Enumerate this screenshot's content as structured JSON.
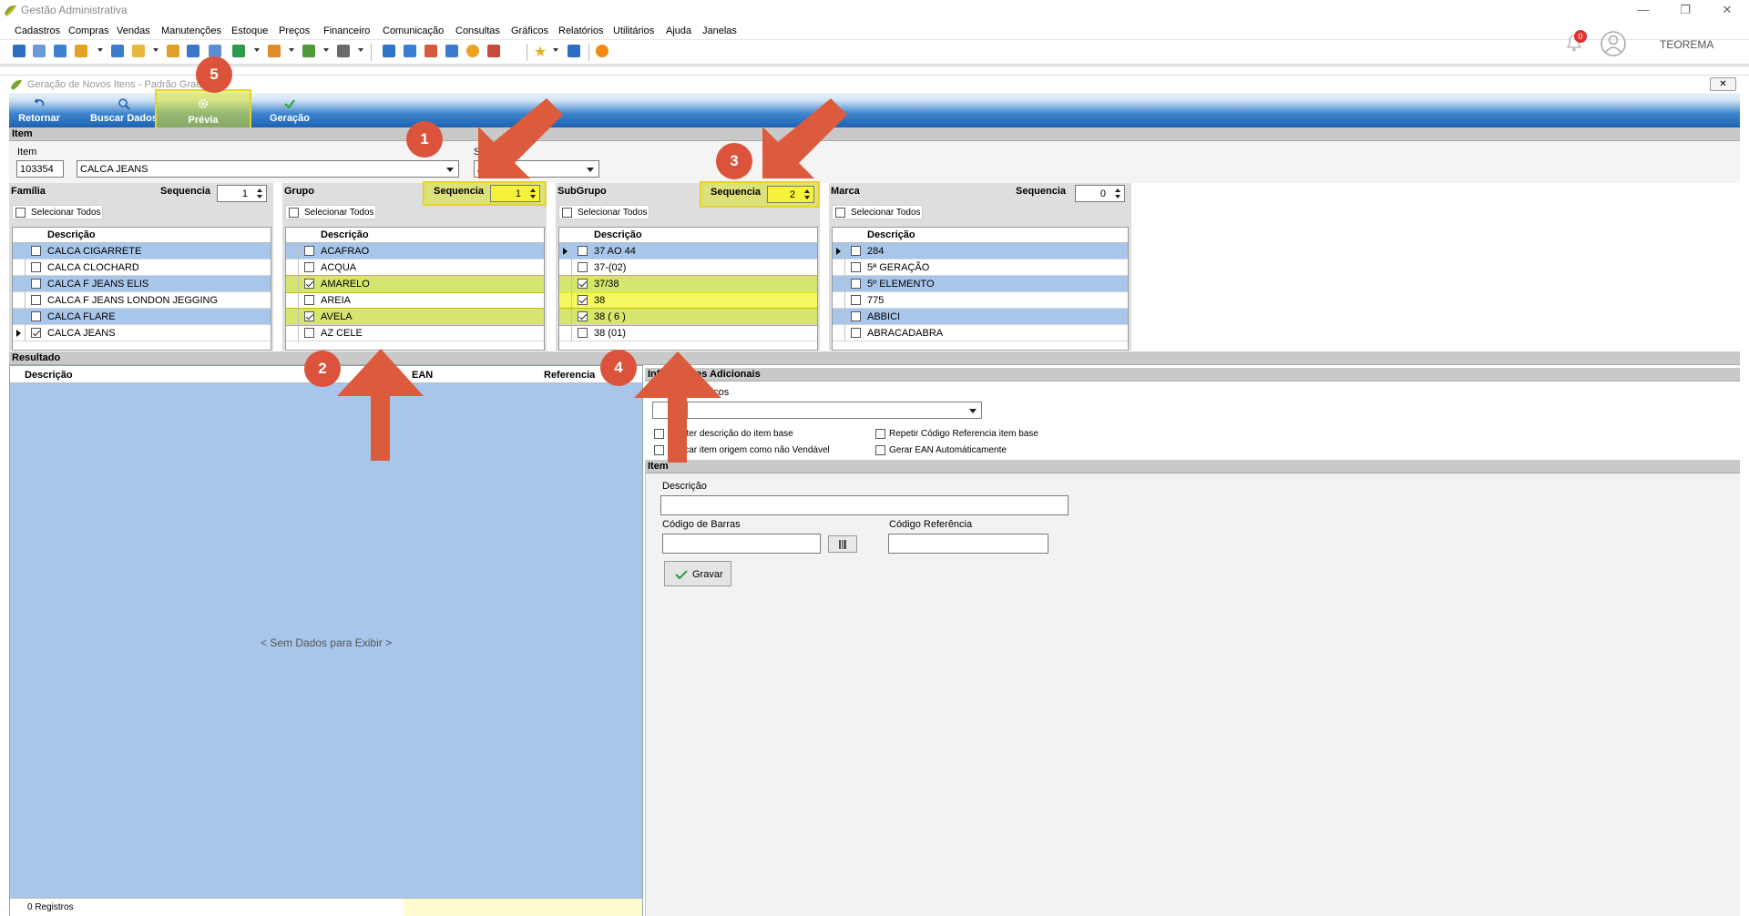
{
  "app": {
    "title": "Gestão Administrativa",
    "user": "TEOREMA",
    "notification_count": "0"
  },
  "menu": [
    "Cadastros",
    "Compras",
    "Vendas",
    "Manutenções",
    "Estoque",
    "Preços",
    "Financeiro",
    "Comunicação",
    "Consultas",
    "Gráficos",
    "Relatórios",
    "Utilitários",
    "Ajuda",
    "Janelas"
  ],
  "window": {
    "title": "Geração de Novos Itens - Padrão Grade"
  },
  "ribbon": {
    "retornar": "Retornar",
    "buscar": "Buscar Dados",
    "previa": "Prévia",
    "geracao": "Geração"
  },
  "item_section": {
    "title": "Item",
    "item_label": "Item",
    "code": "103354",
    "name": "CALCA JEANS",
    "se_label": "Se",
    "se_value": "/"
  },
  "familia": {
    "title": "Família",
    "seq_label": "Sequencia",
    "seq": "1",
    "select_all": "Selecionar Todos",
    "col": "Descrição",
    "rows": [
      {
        "text": "CALCA CIGARRETE",
        "checked": false
      },
      {
        "text": "CALCA CLOCHARD",
        "checked": false
      },
      {
        "text": "CALCA F JEANS ELIS",
        "checked": false
      },
      {
        "text": "CALCA F JEANS LONDON JEGGING",
        "checked": false
      },
      {
        "text": "CALCA FLARE",
        "checked": false
      },
      {
        "text": "CALCA JEANS",
        "checked": true
      }
    ]
  },
  "grupo": {
    "title": "Grupo",
    "seq_label": "Sequencia",
    "seq": "1",
    "select_all": "Selecionar Todos",
    "col": "Descrição",
    "rows": [
      {
        "text": "ACAFRAO",
        "checked": false
      },
      {
        "text": "ACQUA",
        "checked": false
      },
      {
        "text": "AMARELO",
        "checked": true
      },
      {
        "text": "AREIA",
        "checked": false
      },
      {
        "text": "AVELA",
        "checked": true
      },
      {
        "text": "AZ CELE",
        "checked": false
      }
    ]
  },
  "subgrupo": {
    "title": "SubGrupo",
    "seq_label": "Sequencia",
    "seq": "2",
    "select_all": "Selecionar Todos",
    "col": "Descrição",
    "rows": [
      {
        "text": "37 AO 44",
        "checked": false
      },
      {
        "text": "37-(02)",
        "checked": false
      },
      {
        "text": "37/38",
        "checked": true
      },
      {
        "text": "38",
        "checked": true
      },
      {
        "text": "38 ( 6 )",
        "checked": true
      },
      {
        "text": "38 (01)",
        "checked": false
      }
    ]
  },
  "marca": {
    "title": "Marca",
    "seq_label": "Sequencia",
    "seq": "0",
    "select_all": "Selecionar Todos",
    "col": "Descrição",
    "rows": [
      {
        "text": "284",
        "checked": false
      },
      {
        "text": "5ª GERAÇÃO",
        "checked": false
      },
      {
        "text": "5º ELEMENTO",
        "checked": false
      },
      {
        "text": "775",
        "checked": false
      },
      {
        "text": "ABBICI",
        "checked": false
      },
      {
        "text": "ABRACADABRA",
        "checked": false
      }
    ]
  },
  "resultado": {
    "title": "Resultado",
    "col_desc": "Descrição",
    "col_ean": "EAN",
    "col_ref": "Referencia",
    "empty": "< Sem Dados para Exibir >",
    "status": "0 Registros"
  },
  "adicionais": {
    "title": "Informações Adicionais",
    "precos_label": "Preços",
    "opt1": "Manter descrição do item base",
    "opt2": "Marcar item origem como não Vendável",
    "opt3": "Repetir Código Referencia item base",
    "opt4": "Gerar EAN Automáticamente"
  },
  "item_form": {
    "title": "Item",
    "desc_label": "Descrição",
    "barras_label": "Código de Barras",
    "ref_label": "Código Referência",
    "gravar": "Gravar"
  },
  "callouts": [
    "1",
    "2",
    "3",
    "4",
    "5"
  ]
}
